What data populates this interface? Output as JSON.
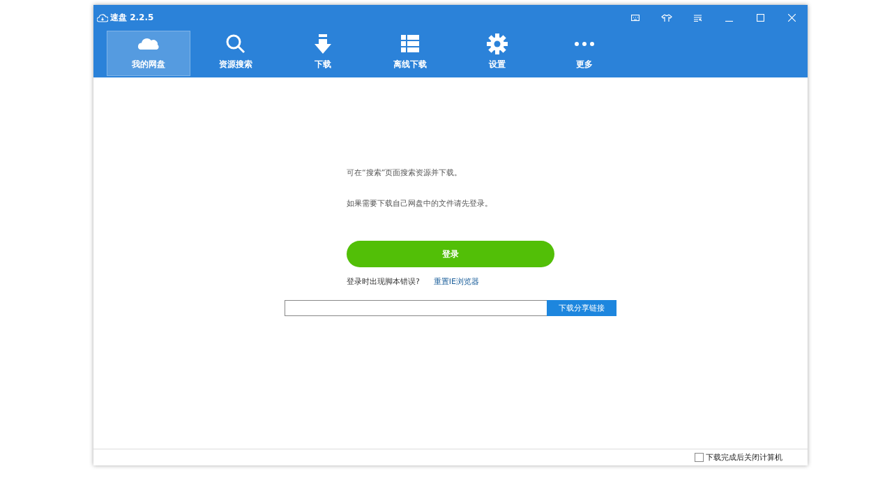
{
  "window": {
    "title": "速盘 2.2.5"
  },
  "tabs": [
    {
      "kind": "cloud",
      "label": "我的网盘",
      "selected": true
    },
    {
      "kind": "search",
      "label": "资源搜索",
      "selected": false
    },
    {
      "kind": "download",
      "label": "下载",
      "selected": false
    },
    {
      "kind": "list",
      "label": "离线下载",
      "selected": false
    },
    {
      "kind": "gear",
      "label": "设置",
      "selected": false
    },
    {
      "kind": "more",
      "label": "更多",
      "selected": false
    }
  ],
  "main": {
    "hint_lines": [
      "可在“搜索”页面搜索资源并下载。",
      "如果需要下载自己网盘中的文件请先登录。"
    ],
    "login_button": "登录",
    "script_error_text": "登录时出现脚本错误?",
    "reset_link": "重置IE浏览器",
    "share_button": "下载分享链接"
  },
  "status_bar": {
    "shutdown_checkbox": {
      "label": "下载完成后关闭计算机",
      "checked": false
    }
  }
}
